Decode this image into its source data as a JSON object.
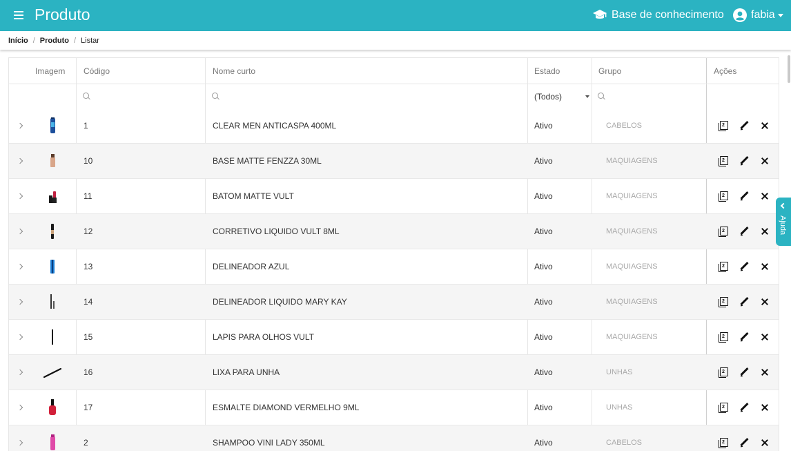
{
  "topbar": {
    "title": "Produto",
    "kb_label": "Base de conhecimento",
    "user_label": "fabia",
    "color": "#2bb3c2"
  },
  "breadcrumb": [
    "Início",
    "Produto",
    "Listar"
  ],
  "table": {
    "headers": {
      "image": "Imagem",
      "code": "Código",
      "name": "Nome curto",
      "status": "Estado",
      "group": "Grupo",
      "actions": "Ações"
    },
    "status_filter": "(Todos)",
    "rows": [
      {
        "code": "1",
        "name": "CLEAR MEN ANTICASPA 400ML",
        "status": "Ativo",
        "group": "CABELOS",
        "thumb": "shampoo-bottle-blue"
      },
      {
        "code": "10",
        "name": "BASE MATTE FENZZA 30ML",
        "status": "Ativo",
        "group": "MAQUIAGENS",
        "thumb": "foundation-bottle"
      },
      {
        "code": "11",
        "name": "BATOM MATTE VULT",
        "status": "Ativo",
        "group": "MAQUIAGENS",
        "thumb": "lipstick"
      },
      {
        "code": "12",
        "name": "CORRETIVO LIQUIDO VULT 8ML",
        "status": "Ativo",
        "group": "MAQUIAGENS",
        "thumb": "concealer"
      },
      {
        "code": "13",
        "name": "DELINEADOR AZUL",
        "status": "Ativo",
        "group": "MAQUIAGENS",
        "thumb": "eyeliner-blue"
      },
      {
        "code": "14",
        "name": "DELINEADOR LIQUIDO MARY KAY",
        "status": "Ativo",
        "group": "MAQUIAGENS",
        "thumb": "liquid-eyeliner"
      },
      {
        "code": "15",
        "name": "LAPIS PARA OLHOS VULT",
        "status": "Ativo",
        "group": "MAQUIAGENS",
        "thumb": "eye-pencil"
      },
      {
        "code": "16",
        "name": "LIXA PARA UNHA",
        "status": "Ativo",
        "group": "UNHAS",
        "thumb": "nail-file"
      },
      {
        "code": "17",
        "name": "ESMALTE DIAMOND VERMELHO 9ML",
        "status": "Ativo",
        "group": "UNHAS",
        "thumb": "nail-polish-red"
      },
      {
        "code": "2",
        "name": "SHAMPOO VINI LADY 350ML",
        "status": "Ativo",
        "group": "CABELOS",
        "thumb": "shampoo-bottle-pink"
      }
    ]
  },
  "help_tab": {
    "label": "Ajuda"
  }
}
